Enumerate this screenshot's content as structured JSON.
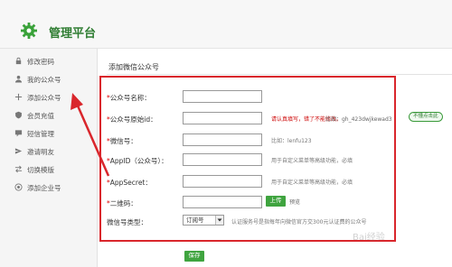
{
  "header": {
    "brand": "管理平台"
  },
  "sidebar": {
    "items": [
      {
        "label": "修改密码",
        "icon": "lock-icon"
      },
      {
        "label": "我的公众号",
        "icon": "user-icon"
      },
      {
        "label": "添加公众号",
        "icon": "plus-icon"
      },
      {
        "label": "会员充值",
        "icon": "shield-icon"
      },
      {
        "label": "短信管理",
        "icon": "message-icon"
      },
      {
        "label": "邀请明友",
        "icon": "invite-icon"
      },
      {
        "label": "切换模版",
        "icon": "swap-icon"
      },
      {
        "label": "添加企业号",
        "icon": "briefcase-icon"
      }
    ]
  },
  "main": {
    "title": "添加微信公众号",
    "form": {
      "name_label": "公众号名称：",
      "original_id_label": "公众号原始id：",
      "original_id_warning": "请认真填写，错了不能修改。",
      "original_id_example": "比如：gh_423dwjkewad3",
      "original_id_help_button": "不懂点击此",
      "wechat_id_label": "微信号：",
      "wechat_id_hint": "比如：lenfu123",
      "appid_label": "AppID（公众号）：",
      "appid_hint": "用于自定义菜单等高级功能，必填",
      "appsecret_label": "AppSecret：",
      "appsecret_hint": "用于自定义菜单等高级功能，必填",
      "qrcode_label": "二维码：",
      "upload_button": "上传",
      "upload_note": "预览",
      "type_label": "微信号类型：",
      "type_selected": "订阅号",
      "type_hint": "认证服务号是指每年向微信官方交300元认证费的公众号",
      "save_button": "保存"
    }
  },
  "colors": {
    "brand_green": "#2f7d32",
    "button_green": "#3fa43f",
    "annotation_red": "#d9262c",
    "required_red": "#dd0000"
  },
  "watermark": "Bai经验"
}
